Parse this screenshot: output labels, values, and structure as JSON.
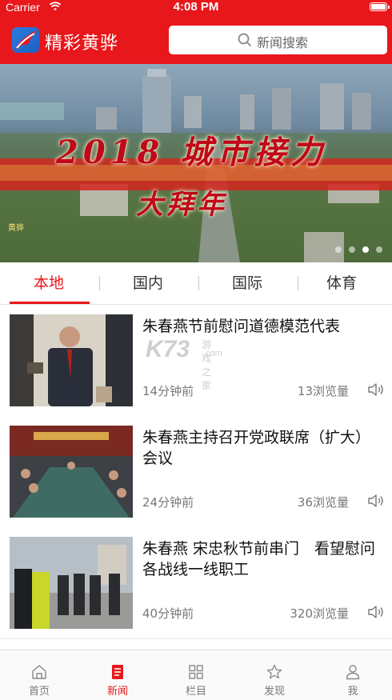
{
  "status_bar": {
    "carrier": "Carrier",
    "time": "4:08 PM"
  },
  "header": {
    "app_title": "精彩黄骅",
    "search_placeholder": "新闻搜索"
  },
  "banner": {
    "title": "2018 城市接力",
    "subtitle": "大拜年",
    "seal_text": "黄骅",
    "dots": 4,
    "active_dot": 3
  },
  "tabs": [
    {
      "label": "本地",
      "active": true
    },
    {
      "label": "国内",
      "active": false
    },
    {
      "label": "国际",
      "active": false
    },
    {
      "label": "体育",
      "active": false
    }
  ],
  "news": [
    {
      "title": "朱春燕节前慰问道德模范代表",
      "time": "14分钟前",
      "views": "13浏览量"
    },
    {
      "title": "朱春燕主持召开党政联席（扩大）会议",
      "time": "24分钟前",
      "views": "36浏览量"
    },
    {
      "title": "朱春燕 宋忠秋节前串门　看望慰问各战线一线职工",
      "time": "40分钟前",
      "views": "320浏览量"
    }
  ],
  "watermark": {
    "main": "K73",
    "side_top": "游戏之家",
    "side_bottom": ".com"
  },
  "bottom_nav": [
    {
      "label": "首页",
      "icon": "home-icon",
      "active": false
    },
    {
      "label": "新闻",
      "icon": "news-icon",
      "active": true
    },
    {
      "label": "栏目",
      "icon": "grid-icon",
      "active": false
    },
    {
      "label": "发现",
      "icon": "star-icon",
      "active": false
    },
    {
      "label": "我",
      "icon": "user-icon",
      "active": false
    }
  ],
  "colors": {
    "brand_red": "#e8171b",
    "text_gray": "#777777"
  }
}
